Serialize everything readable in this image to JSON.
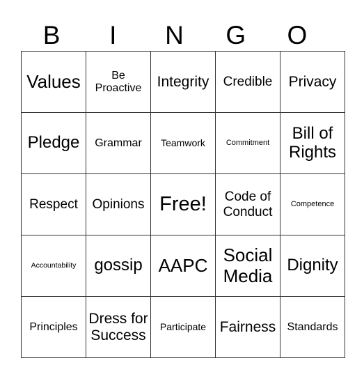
{
  "header": [
    "B",
    "I",
    "N",
    "G",
    "O"
  ],
  "board": [
    [
      "Values",
      "Be Proactive",
      "Integrity",
      "Credible",
      "Privacy"
    ],
    [
      "Pledge",
      "Grammar",
      "Teamwork",
      "Commitment",
      "Bill of Rights"
    ],
    [
      "Respect",
      "Opinions",
      "Free!",
      "Code of Conduct",
      "Competence"
    ],
    [
      "Accountability",
      "gossip",
      "AAPC",
      "Social Media",
      "Dignity"
    ],
    [
      "Principles",
      "Dress for Success",
      "Participate",
      "Fairness",
      "Standards"
    ]
  ],
  "free_space": "Free!"
}
